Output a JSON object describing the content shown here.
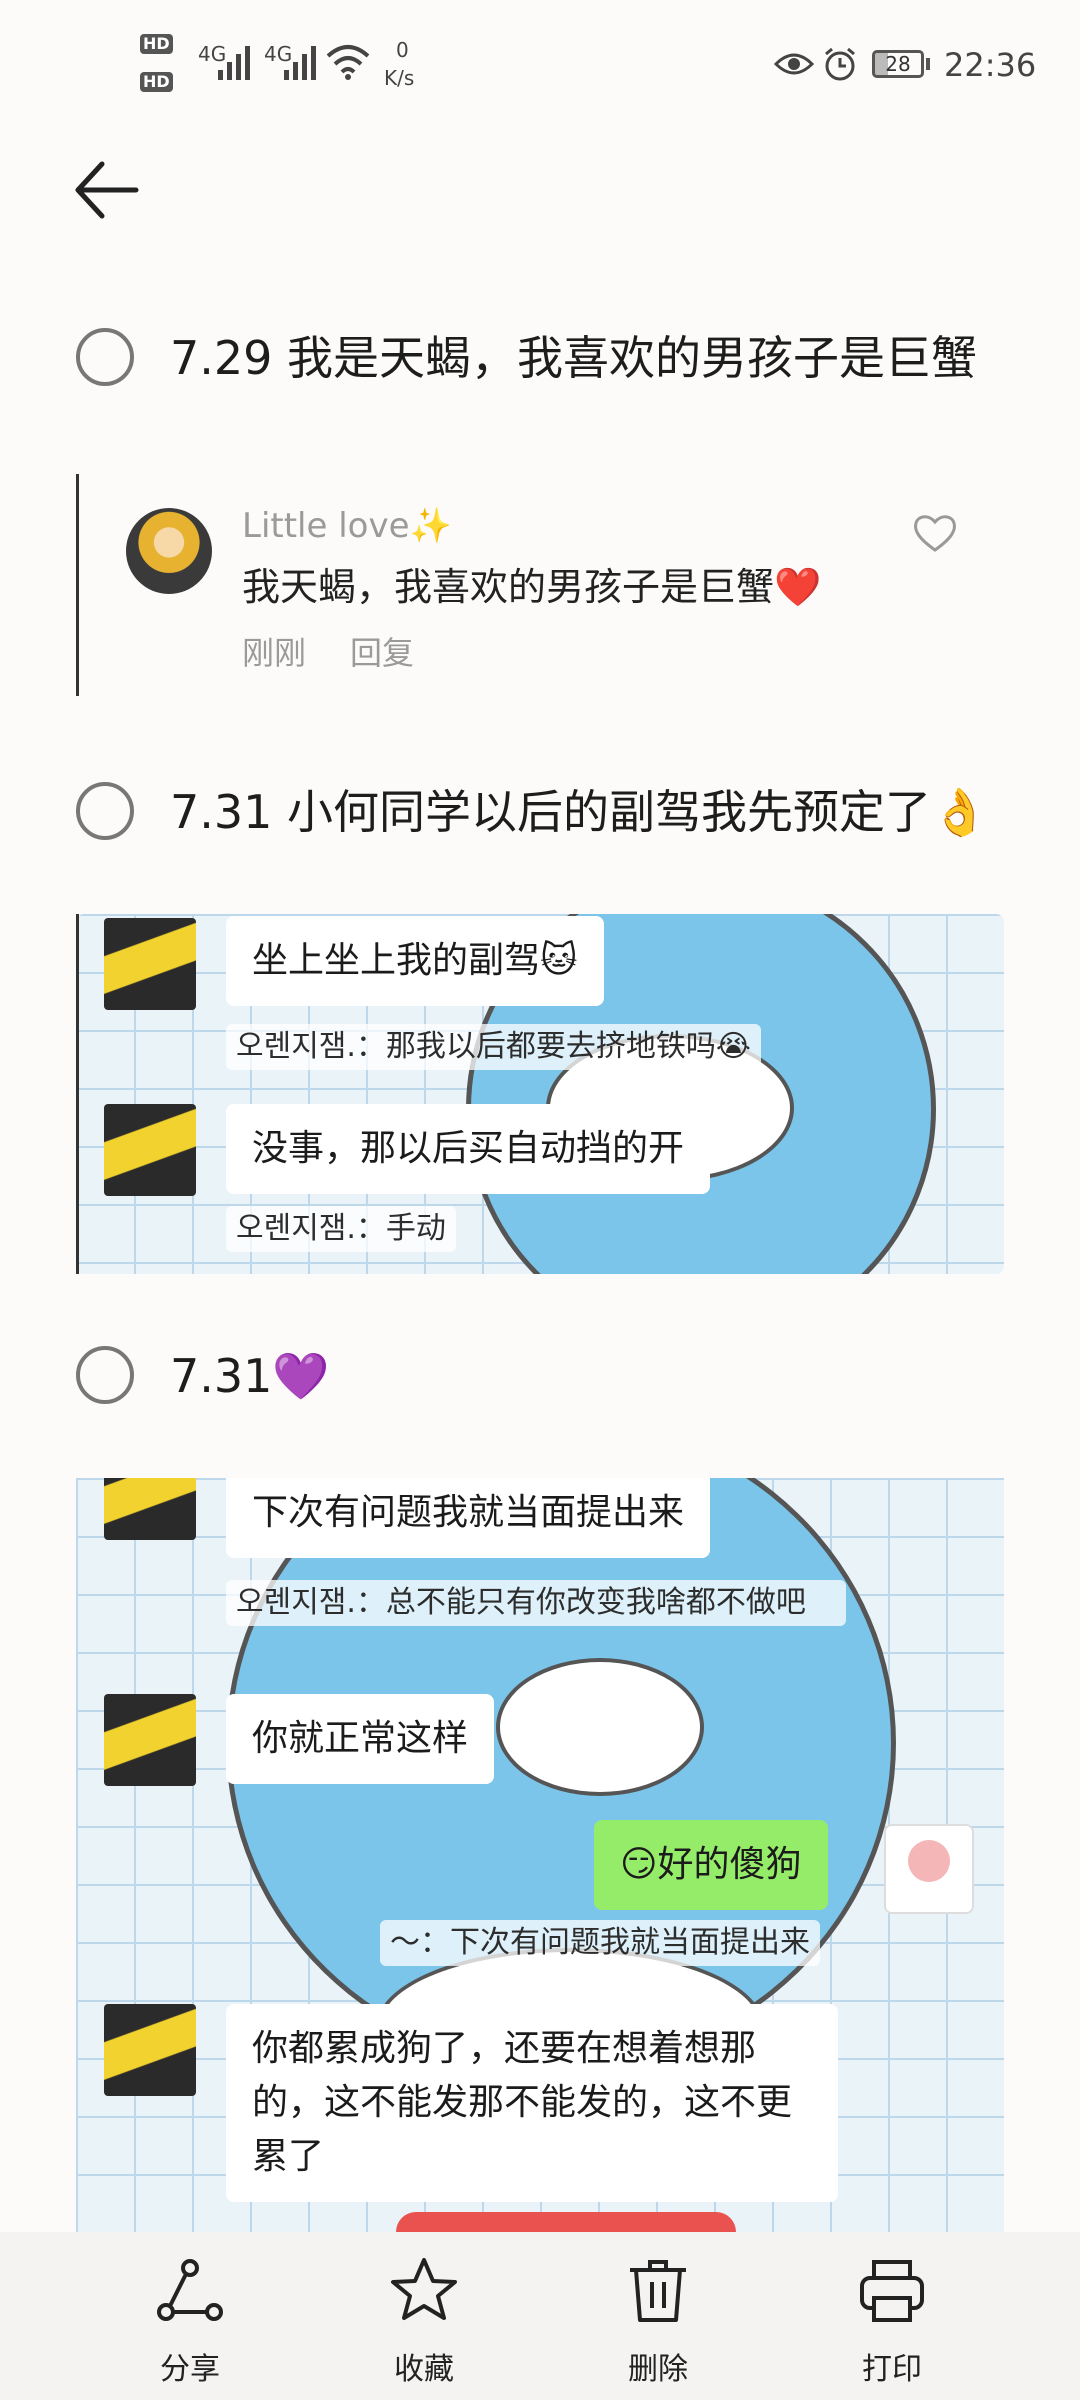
{
  "status_bar": {
    "hd1": "HD",
    "hd2": "HD",
    "net1": "4G",
    "net2": "4G",
    "speed_value": "0",
    "speed_unit": "K/s",
    "battery": "28",
    "time": "22:36"
  },
  "todos": [
    {
      "date": "7.29",
      "text": "我是天蝎，我喜欢的男孩子是巨蟹"
    },
    {
      "date": "7.31",
      "text": "小何同学以后的副驾我先预定了👌"
    },
    {
      "date": "7.31",
      "text": "💜"
    }
  ],
  "comment": {
    "name": "Little love✨",
    "text": "我天蝎，我喜欢的男孩子是巨蟹❤️",
    "time": "刚刚",
    "reply": "回复"
  },
  "chat1": [
    {
      "type": "bubble",
      "text": "坐上坐上我的副驾🐱"
    },
    {
      "type": "quote",
      "text": "오렌지잼.：那我以后都要去挤地铁吗😭"
    },
    {
      "type": "bubble",
      "text": "没事，那以后买自动挡的开"
    },
    {
      "type": "quote",
      "text": "오렌지잼.：手动"
    }
  ],
  "chat2": [
    {
      "type": "bubble",
      "text": "下次有问题我就当面提出来"
    },
    {
      "type": "quote",
      "text": "오렌지잼.：总不能只有你改变我啥都不做吧"
    },
    {
      "type": "bubble",
      "text": "你就正常这样"
    },
    {
      "type": "bubble_self",
      "text": "😏好的傻狗"
    },
    {
      "type": "quote",
      "text": "～：下次有问题我就当面提出来"
    },
    {
      "type": "bubble",
      "text": "你都累成狗了，还要在想着想那的，这不能发那不能发的，这不更累了"
    }
  ],
  "toolbar": [
    {
      "icon": "share-icon",
      "label": "分享"
    },
    {
      "icon": "star-icon",
      "label": "收藏"
    },
    {
      "icon": "trash-icon",
      "label": "删除"
    },
    {
      "icon": "printer-icon",
      "label": "打印"
    }
  ],
  "colors": {
    "background": "#fcfbf9",
    "bubble_self": "#95ec69",
    "grid_line": "#bcd8ea"
  }
}
